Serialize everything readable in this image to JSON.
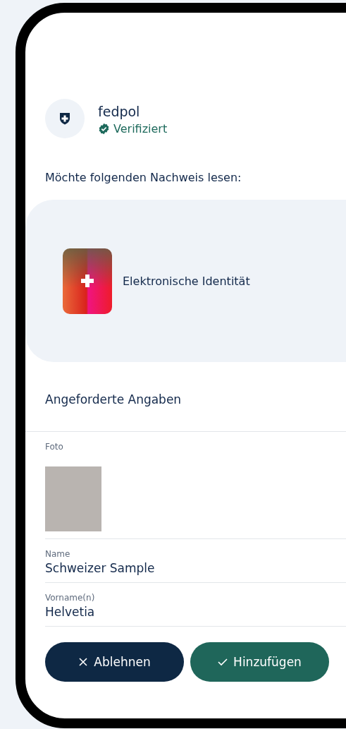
{
  "verifier": {
    "name": "fedpol",
    "status": "Verifiziert",
    "verified": true
  },
  "request_text": "Möchte folgenden Nachweis lesen:",
  "credential": {
    "title": "Elektronische Identität"
  },
  "section_title": "Angeforderte Angaben",
  "fields": [
    {
      "kind": "photo",
      "label": "Foto"
    },
    {
      "kind": "text",
      "label": "Name",
      "value": "Schweizer Sample"
    },
    {
      "kind": "text",
      "label": "Vorname(n)",
      "value": "Helvetia"
    }
  ],
  "buttons": [
    {
      "kind": "reject",
      "label": "Ablehnen"
    },
    {
      "kind": "accept",
      "label": "Hinzufügen"
    }
  ]
}
